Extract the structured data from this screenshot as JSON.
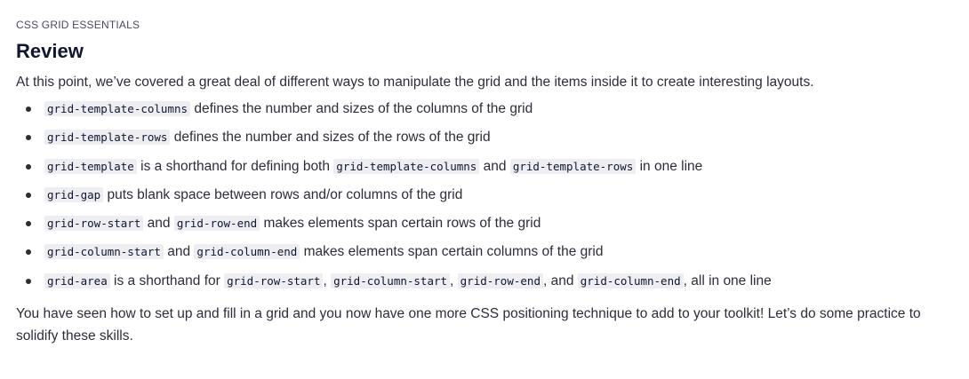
{
  "header": {
    "eyebrow": "CSS GRID ESSENTIALS",
    "title": "Review"
  },
  "intro": "At this point, we’ve covered a great deal of different ways to manipulate the grid and the items inside it to create interesting layouts.",
  "bullets": [
    {
      "parts": [
        {
          "type": "code",
          "text": "grid-template-columns"
        },
        {
          "type": "text",
          "text": " defines the number and sizes of the columns of the grid"
        }
      ]
    },
    {
      "parts": [
        {
          "type": "code",
          "text": "grid-template-rows"
        },
        {
          "type": "text",
          "text": " defines the number and sizes of the rows of the grid"
        }
      ]
    },
    {
      "parts": [
        {
          "type": "code",
          "text": "grid-template"
        },
        {
          "type": "text",
          "text": " is a shorthand for defining both "
        },
        {
          "type": "code",
          "text": "grid-template-columns"
        },
        {
          "type": "text",
          "text": " and "
        },
        {
          "type": "code",
          "text": "grid-template-rows"
        },
        {
          "type": "text",
          "text": " in one line"
        }
      ]
    },
    {
      "parts": [
        {
          "type": "code",
          "text": "grid-gap"
        },
        {
          "type": "text",
          "text": " puts blank space between rows and/or columns of the grid"
        }
      ]
    },
    {
      "parts": [
        {
          "type": "code",
          "text": "grid-row-start"
        },
        {
          "type": "text",
          "text": " and "
        },
        {
          "type": "code",
          "text": "grid-row-end"
        },
        {
          "type": "text",
          "text": " makes elements span certain rows of the grid"
        }
      ]
    },
    {
      "parts": [
        {
          "type": "code",
          "text": "grid-column-start"
        },
        {
          "type": "text",
          "text": " and "
        },
        {
          "type": "code",
          "text": "grid-column-end"
        },
        {
          "type": "text",
          "text": " makes elements span certain columns of the grid"
        }
      ]
    },
    {
      "parts": [
        {
          "type": "code",
          "text": "grid-area"
        },
        {
          "type": "text",
          "text": " is a shorthand for "
        },
        {
          "type": "code",
          "text": "grid-row-start"
        },
        {
          "type": "text",
          "text": ", "
        },
        {
          "type": "code",
          "text": "grid-column-start"
        },
        {
          "type": "text",
          "text": ", "
        },
        {
          "type": "code",
          "text": "grid-row-end"
        },
        {
          "type": "text",
          "text": ", and "
        },
        {
          "type": "code",
          "text": "grid-column-end"
        },
        {
          "type": "text",
          "text": ", all in one line"
        }
      ]
    }
  ],
  "outro": "You have seen how to set up and fill in a grid and you now have one more CSS positioning technique to add to your toolkit! Let’s do some practice to solidify these skills."
}
